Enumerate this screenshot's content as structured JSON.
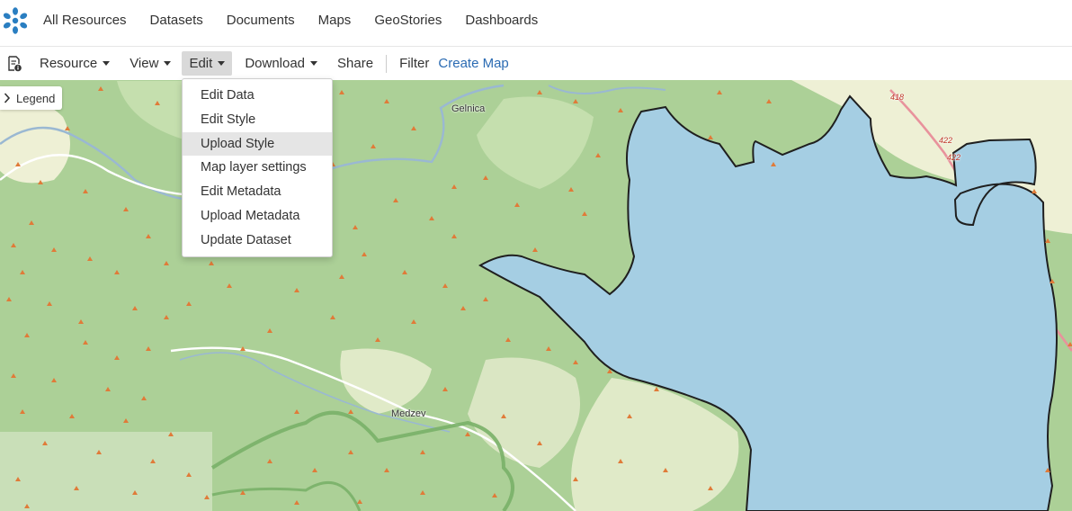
{
  "nav": {
    "items": [
      "All Resources",
      "Datasets",
      "Documents",
      "Maps",
      "GeoStories",
      "Dashboards"
    ]
  },
  "toolbar": {
    "resource": "Resource",
    "view": "View",
    "edit": "Edit",
    "download": "Download",
    "share": "Share",
    "filter": "Filter",
    "create_map": "Create Map"
  },
  "edit_menu": {
    "items": [
      "Edit Data",
      "Edit Style",
      "Upload Style",
      "Map layer settings",
      "Edit Metadata",
      "Upload Metadata",
      "Update Dataset"
    ],
    "hovered": "Upload Style"
  },
  "legend": {
    "label": "Legend"
  },
  "map": {
    "places": [
      "Gelnica",
      "Medzev"
    ],
    "roads": [
      "418",
      "422",
      "422"
    ],
    "colors": {
      "forest": "#acd097",
      "water": "#a5cee3",
      "symbol": "#e07b39",
      "rivers": "#9ab8d2"
    }
  },
  "colors": {
    "link": "#2b6bb3",
    "logo": "#2a7ec1"
  }
}
